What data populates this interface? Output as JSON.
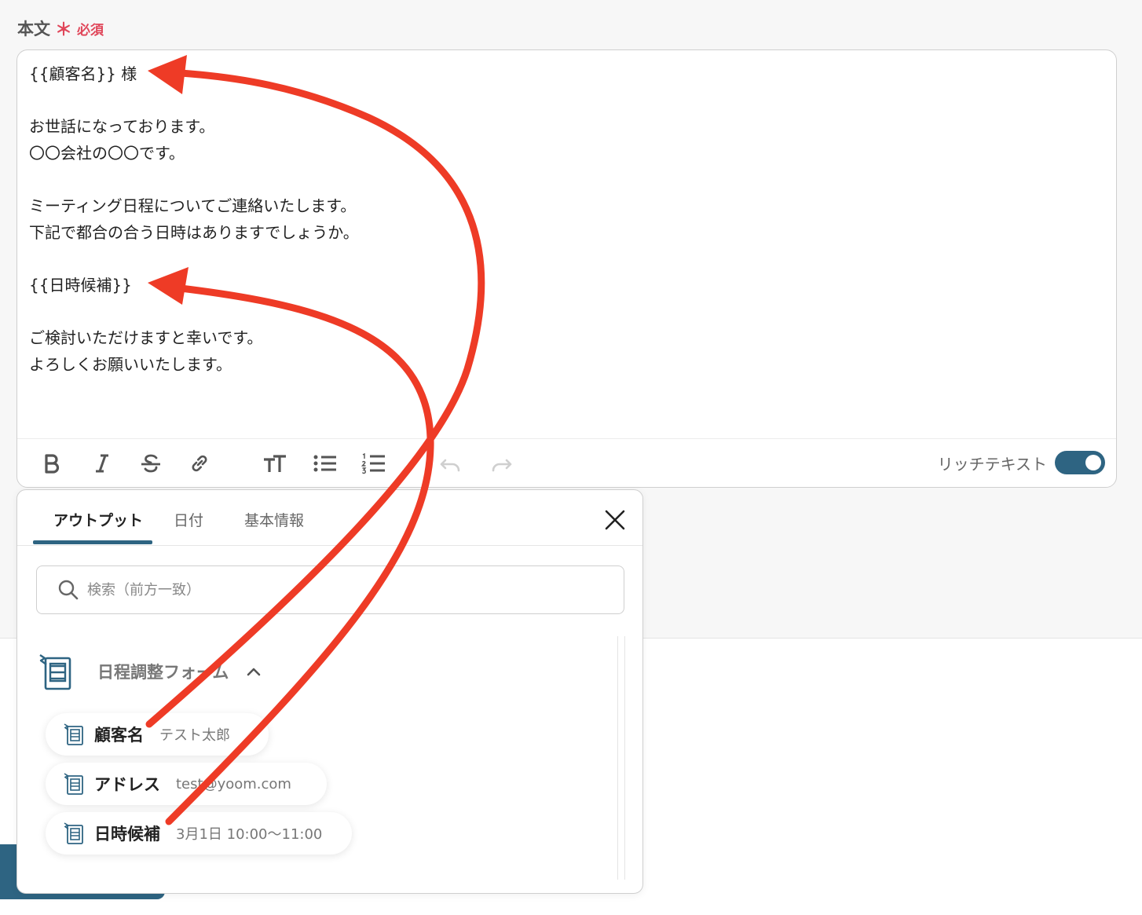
{
  "field": {
    "label": "本文",
    "required_star": "＊",
    "required_label": "必須"
  },
  "editor": {
    "lines": [
      "{{顧客名}} 様",
      "",
      "お世話になっております。",
      "〇〇会社の〇〇です。",
      "",
      "ミーティング日程についてご連絡いたします。",
      "下記で都合の合う日時はありますでしょうか。",
      "",
      "{{日時候補}}",
      "",
      "ご検討いただけますと幸いです。",
      "よろしくお願いいたします。"
    ],
    "rich_text_label": "リッチテキスト",
    "rich_text_enabled": true
  },
  "panel": {
    "tabs": [
      {
        "label": "アウトプット",
        "active": true
      },
      {
        "label": "日付",
        "active": false
      },
      {
        "label": "基本情報",
        "active": false
      }
    ],
    "search_placeholder": "検索（前方一致）",
    "group_title": "日程調整フォーム",
    "items": [
      {
        "name": "顧客名",
        "value": "テスト太郎"
      },
      {
        "name": "アドレス",
        "value": "test@yoom.com"
      },
      {
        "name": "日時候補",
        "value": "3月1日 10:00〜11:00"
      }
    ]
  },
  "colors": {
    "accent": "#2e6482",
    "required": "#e0475a",
    "arrow": "#ee3b26"
  }
}
